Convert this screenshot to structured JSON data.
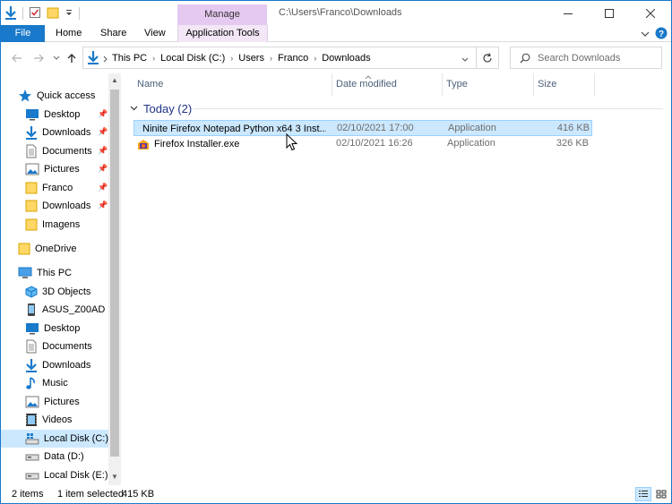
{
  "window": {
    "title": "C:\\Users\\Franco\\Downloads",
    "manage_tab": "Manage"
  },
  "ribbon": {
    "tabs": [
      {
        "label": "File"
      },
      {
        "label": "Home"
      },
      {
        "label": "Share"
      },
      {
        "label": "View"
      },
      {
        "label": "Application Tools"
      }
    ]
  },
  "address": {
    "crumbs": [
      "This PC",
      "Local Disk (C:)",
      "Users",
      "Franco",
      "Downloads"
    ]
  },
  "search": {
    "placeholder": "Search Downloads"
  },
  "nav": {
    "quick_access": "Quick access",
    "quick_items": [
      "Desktop",
      "Downloads",
      "Documents",
      "Pictures",
      "Franco",
      "Downloads",
      "Imagens"
    ],
    "onedrive": "OneDrive",
    "this_pc": "This PC",
    "pc_items": [
      "3D Objects",
      "ASUS_Z00AD",
      "Desktop",
      "Documents",
      "Downloads",
      "Music",
      "Pictures",
      "Videos",
      "Local Disk (C:)",
      "Data (D:)",
      "Local Disk (E:)"
    ]
  },
  "columns": {
    "name": "Name",
    "date": "Date modified",
    "type": "Type",
    "size": "Size"
  },
  "group": {
    "label": "Today (2)"
  },
  "files": [
    {
      "name": "Ninite Firefox Notepad Python x64 3 Inst...",
      "date": "02/10/2021 17:00",
      "type": "Application",
      "size": "416 KB",
      "selected": true
    },
    {
      "name": "Firefox Installer.exe",
      "date": "02/10/2021 16:26",
      "type": "Application",
      "size": "326 KB",
      "selected": false
    }
  ],
  "status": {
    "count": "2 items",
    "selection": "1 item selected",
    "selection_size": "415 KB"
  },
  "colors": {
    "accent": "#1979ca",
    "manage": "#e6c9f1",
    "selection": "#cce8ff",
    "folder": "#ffd766"
  }
}
